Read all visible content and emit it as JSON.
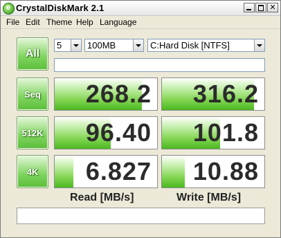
{
  "window": {
    "title": "CrystalDiskMark 2.1",
    "icon": "cdm-app-icon",
    "icon_glyph": "e",
    "controls": {
      "minimize": "minimize-icon",
      "maximize": "maximize-icon",
      "close": "close-icon",
      "close_glyph": "✕"
    }
  },
  "menu": {
    "items": [
      "File",
      "Edit",
      "Theme",
      "Help",
      "Language"
    ]
  },
  "toolbar": {
    "all_label": "All",
    "count_value": "5",
    "size_value": "100MB",
    "drive_value": "C:Hard Disk [NTFS]",
    "comment_value": ""
  },
  "tests": [
    {
      "label": "Seq",
      "read": "268.2",
      "write": "316.2",
      "read_fill": 0.85,
      "write_fill": 0.9
    },
    {
      "label": "512K",
      "read": "96.40",
      "write": "101.8",
      "read_fill": 0.55,
      "write_fill": 0.57
    },
    {
      "label": "4K",
      "read": "6.827",
      "write": "10.88",
      "read_fill": 0.18,
      "write_fill": 0.22
    }
  ],
  "columns": {
    "read": "Read [MB/s]",
    "write": "Write [MB/s]"
  },
  "status": {
    "text": ""
  },
  "colors": {
    "accent": "#5cbd3a",
    "bar": "#7fd44e"
  }
}
